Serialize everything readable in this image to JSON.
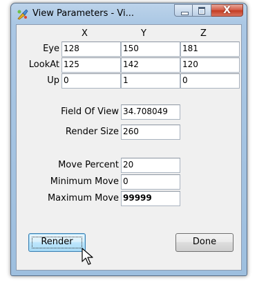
{
  "window": {
    "title": "View Parameters - Vi...",
    "icon": "paintbrush-app-icon",
    "buttons": {
      "minimize": "minimize",
      "maximize": "maximize",
      "close": "X"
    }
  },
  "grid": {
    "columns": [
      "X",
      "Y",
      "Z"
    ],
    "rows": [
      {
        "label": "Eye",
        "values": [
          "128",
          "150",
          "181"
        ]
      },
      {
        "label": "LookAt",
        "values": [
          "125",
          "142",
          "120"
        ]
      },
      {
        "label": "Up",
        "values": [
          "0",
          "1",
          "0"
        ]
      }
    ]
  },
  "view": {
    "fov_label": "Field Of View",
    "fov_value": "34.708049",
    "render_size_label": "Render Size",
    "render_size_value": "260"
  },
  "movement": {
    "percent_label": "Move Percent",
    "percent_value": "20",
    "min_label": "Minimum Move",
    "min_value": "0",
    "max_label": "Maximum Move",
    "max_value": "99999"
  },
  "actions": {
    "render_label": "Render",
    "done_label": "Done"
  }
}
